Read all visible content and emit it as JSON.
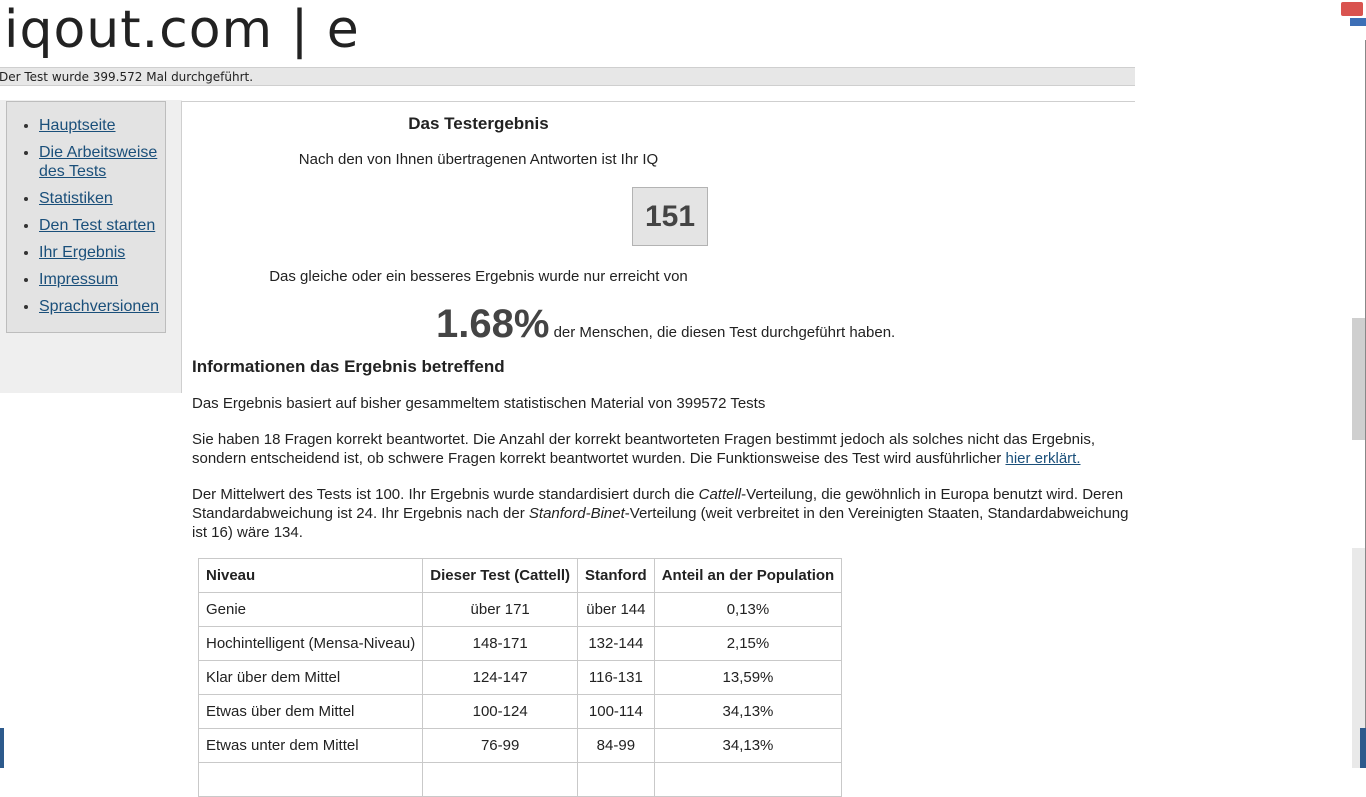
{
  "logo": "iqout.com | e",
  "counter_text": "Der Test wurde 399.572 Mal durchgeführt.",
  "sidebar": {
    "items": [
      {
        "label": "Hauptseite"
      },
      {
        "label": "Die Arbeitsweise des Tests"
      },
      {
        "label": "Statistiken"
      },
      {
        "label": "Den Test starten"
      },
      {
        "label": "Ihr Ergebnis"
      },
      {
        "label": "Impressum"
      },
      {
        "label": "Sprachversionen"
      }
    ]
  },
  "result": {
    "title": "Das Testergebnis",
    "intro": "Nach den von Ihnen übertragenen Antworten ist Ihr IQ",
    "iq": "151",
    "better_text": "Das gleiche oder ein besseres Ergebnis wurde nur erreicht von",
    "percent": "1.68%",
    "percent_suffix": " der Menschen, die diesen Test durchgeführt haben."
  },
  "info": {
    "title": "Informationen das Ergebnis betreffend",
    "p1": "Das Ergebnis basiert auf bisher gesammeltem statistischen Material von 399572 Tests",
    "p2_text": "Sie haben 18 Fragen korrekt beantwortet. Die Anzahl der korrekt beantworteten Fragen bestimmt jedoch als solches nicht das Ergebnis, sondern entscheidend ist, ob schwere Fragen korrekt beantwortet wurden. Die Funktionsweise des Test wird ausführlicher ",
    "p2_link": "hier erklärt.",
    "p3_a": "Der Mittelwert des Tests ist 100. Ihr Ergebnis wurde standardisiert durch die ",
    "p3_cattell": "Cattell",
    "p3_b": "-Verteilung, die gewöhnlich in Europa benutzt wird. Deren Standardabweichung ist 24. Ihr Ergebnis nach der ",
    "p3_stanford": "Stanford-Binet",
    "p3_c": "-Verteilung (weit verbreitet in den Vereinigten Staaten, Standardabweichung ist 16) wäre 134."
  },
  "table": {
    "headers": [
      "Niveau",
      "Dieser Test (Cattell)",
      "Stanford",
      "Anteil an der Population"
    ],
    "rows": [
      [
        "Genie",
        "über 171",
        "über 144",
        "0,13%"
      ],
      [
        "Hochintelligent (Mensa-Niveau)",
        "148-171",
        "132-144",
        "2,15%"
      ],
      [
        "Klar über dem Mittel",
        "124-147",
        "116-131",
        "13,59%"
      ],
      [
        "Etwas über dem Mittel",
        "100-124",
        "100-114",
        "34,13%"
      ],
      [
        "Etwas unter dem Mittel",
        "76-99",
        "84-99",
        "34,13%"
      ],
      [
        "",
        "",
        "",
        ""
      ]
    ]
  }
}
